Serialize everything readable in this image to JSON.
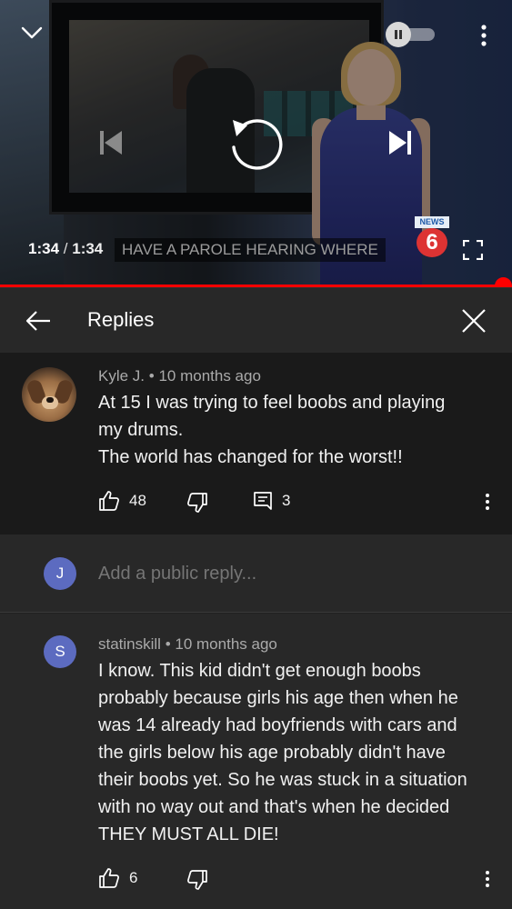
{
  "player": {
    "current_time": "1:34",
    "separator": "/",
    "duration": "1:34",
    "caption": "HAVE A PAROLE HEARING WHERE",
    "channel_logo_tag": "NEWS",
    "channel_logo_number": "6",
    "progress_fraction": 1.0,
    "icons": {
      "collapse": "chevron-down-icon",
      "autoplay": "pause-icon",
      "more": "more-vert-icon",
      "previous": "skip-previous-icon",
      "replay": "replay-icon",
      "next": "skip-next-icon",
      "fullscreen": "fullscreen-icon"
    },
    "colors": {
      "progress": "#ff0000"
    }
  },
  "replies_panel": {
    "title": "Replies",
    "back_icon": "arrow-back-icon",
    "close_icon": "close-icon"
  },
  "parent_comment": {
    "author": "Kyle J.",
    "dot": "•",
    "time": "10 months ago",
    "lines": [
      "At 15 I was trying to feel boobs and playing",
      "my drums.",
      "The world has changed for the worst!!"
    ],
    "likes": "48",
    "replies_count": "3",
    "avatar": "dog-photo"
  },
  "reply_box": {
    "avatar_letter": "J",
    "placeholder": "Add a public reply...",
    "colors": {
      "avatar": "#5c6bc0"
    }
  },
  "reply_comment": {
    "avatar_letter": "S",
    "author": "statinskill",
    "dot": "•",
    "time": "10 months ago",
    "lines": [
      "I know. This kid didn't get enough boobs",
      "probably because girls his age then when he",
      "was 14 already had boyfriends with cars and",
      "the girls below his age probably didn't have",
      "their boobs yet. So he was stuck in a situation",
      "with no way out and that's when he decided",
      "THEY MUST ALL DIE!"
    ],
    "likes": "6",
    "colors": {
      "avatar": "#5c6bc0"
    }
  }
}
